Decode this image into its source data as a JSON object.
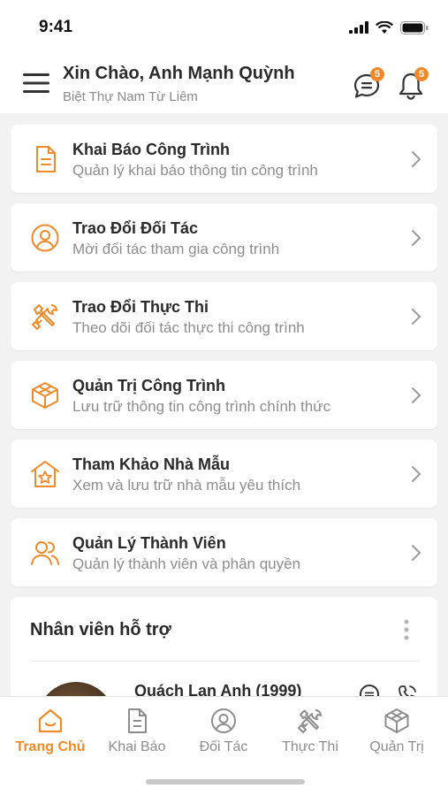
{
  "status_bar": {
    "time": "9:41"
  },
  "header": {
    "greeting": "Xin Chào, Anh Mạnh Quỳnh",
    "project": "Biệt Thự Nam Từ Liêm",
    "messages_badge": "5",
    "notifications_badge": "5"
  },
  "menu": [
    {
      "title": "Khai Báo Công Trình",
      "subtitle": "Quản lý khai báo thông tin công trình",
      "icon": "document-icon"
    },
    {
      "title": "Trao Đổi Đối Tác",
      "subtitle": "Mời đối tác tham gia công trình",
      "icon": "user-circle-icon"
    },
    {
      "title": "Trao Đổi Thực Thi",
      "subtitle": "Theo dõi đối tác thực thi công trình",
      "icon": "tools-icon"
    },
    {
      "title": "Quản Trị Công Trình",
      "subtitle": "Lưu trữ thông tin công trình chính thức",
      "icon": "box-icon"
    },
    {
      "title": "Tham Khảo Nhà Mẫu",
      "subtitle": "Xem và lưu trữ nhà mẫu yêu thích",
      "icon": "house-star-icon"
    },
    {
      "title": "Quản Lý Thành Viên",
      "subtitle": "Quản lý thành viên và phân quyền",
      "icon": "members-icon"
    }
  ],
  "support": {
    "title": "Nhân viên hỗ trợ",
    "staff_name": "Quách Lan Anh (1999)"
  },
  "tabs": [
    {
      "label": "Trang Chủ",
      "active": true
    },
    {
      "label": "Khai Báo",
      "active": false
    },
    {
      "label": "Đối Tác",
      "active": false
    },
    {
      "label": "Thực Thi",
      "active": false
    },
    {
      "label": "Quản Trị",
      "active": false
    }
  ],
  "colors": {
    "accent": "#EE8A2A",
    "text_primary": "#2A2A2A",
    "text_secondary": "#8D8D8D",
    "background": "#F2F2F2"
  }
}
